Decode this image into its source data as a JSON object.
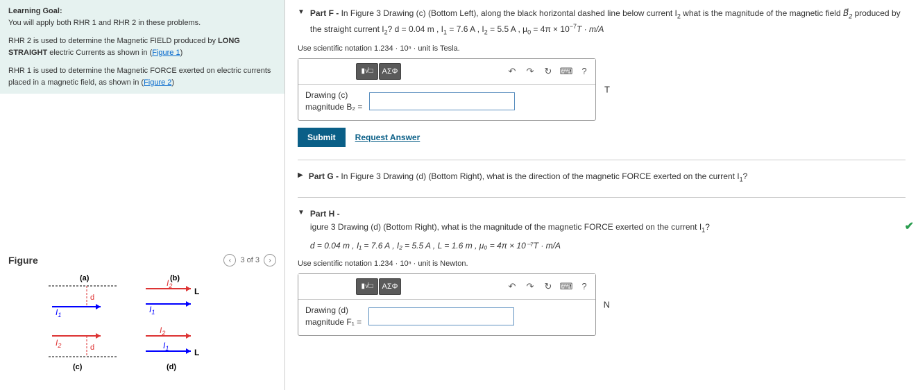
{
  "learning_goal": {
    "title": "Learning Goal:",
    "l1": "You will apply both RHR 1 and RHR 2 in these problems.",
    "l2a": "RHR 2 is used to determine the Magnetic FIELD produced by ",
    "l2b": "LONG STRAIGHT",
    "l2c": " electric Currents as shown in (",
    "l2link": "Figure 1",
    "l2d": ")",
    "l3a": "RHR 1 is used to determine the Magnetic FORCE exerted on electric currents placed in a magnetic field, as shown in (",
    "l3link": "Figure 2",
    "l3b": ")"
  },
  "figure": {
    "title": "Figure",
    "pager": "3 of 3",
    "labels": {
      "a": "(a)",
      "b": "(b)",
      "c": "(c)",
      "d": "(d)",
      "d_": "d",
      "L": "L",
      "I1": "I",
      "I2": "I",
      "s1": "1",
      "s2": "2"
    }
  },
  "partF": {
    "title": "Part F - ",
    "text1": "In Figure 3 Drawing (c) (Bottom Left), along the black horizontal dashed line below current I",
    "text2": " what is the magnitude of the magnetic field ",
    "text3": " produced by the straight current I",
    "text4": "? d = 0.04 m , I",
    "text5": " = 7.6 A , I",
    "text6": " = 5.5 A , μ",
    "text7": " = 4π × 10",
    "text8": "T · m/A",
    "exp": "−7",
    "sub0": "0",
    "sub1": "1",
    "sub2": "2",
    "Bvec": "B⃗",
    "Bsub": "2",
    "hint": "Use scientific notation 1.234 · 10ⁿ · unit is Tesla.",
    "lbl1": "Drawing (c)",
    "lbl2": "magnitude B₂ =",
    "unit": "T",
    "greek": "ΑΣΦ",
    "submit": "Submit",
    "req": "Request Answer"
  },
  "partG": {
    "title": "Part G - ",
    "text": "In Figure 3 Drawing (d) (Bottom Right), what is the direction of the magnetic FORCE  exerted on the current I",
    "sub": "1",
    "q": "?"
  },
  "partH": {
    "title": "Part H -",
    "text1": "igure 3 Drawing (d) (Bottom Right), what is the magnitude of the magnetic FORCE  exerted on the current I",
    "sub1": "1",
    "q": "?",
    "params": "d = 0.04 m , I₁ = 7.6 A , I₂ = 5.5 A , L = 1.6 m , μ₀ = 4π × 10⁻⁷T · m/A",
    "hint": "Use scientific notation 1.234 · 10ⁿ · unit is Newton.",
    "lbl1": "Drawing (d)",
    "lbl2": "magnitude F₁ =",
    "unit": "N",
    "greek": "ΑΣΦ"
  },
  "icons": {
    "undo": "↶",
    "redo": "↷",
    "reset": "↻",
    "kb": "⌨",
    "help": "?",
    "sqrt": "√□"
  }
}
